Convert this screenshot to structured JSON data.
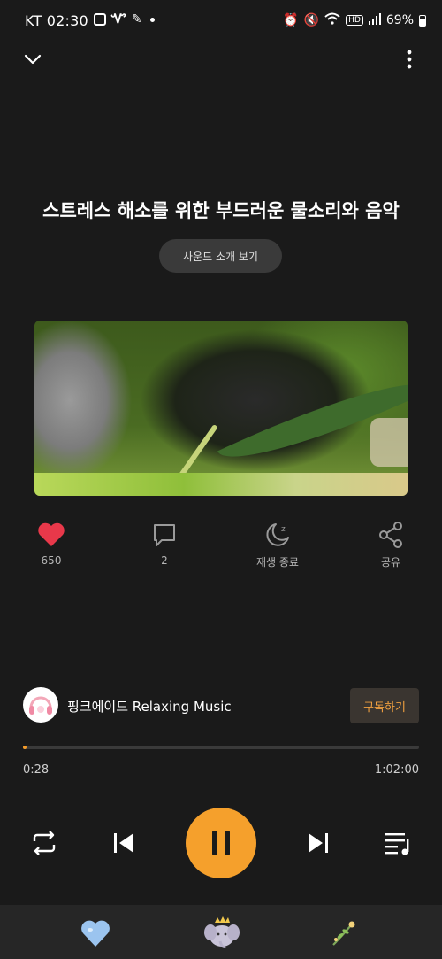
{
  "status_bar": {
    "carrier": "KT",
    "time": "02:30",
    "battery": "69%"
  },
  "track": {
    "title": "스트레스 해소를 위한 부드러운 물소리와 음악",
    "intro_button": "사운드 소개 보기"
  },
  "actions": {
    "like_count": "650",
    "comment_count": "2",
    "sleep_timer_label": "재생 종료",
    "share_label": "공유"
  },
  "channel": {
    "name": "핑크에이드 Relaxing Music",
    "subscribe_label": "구독하기"
  },
  "playback": {
    "current_time": "0:28",
    "total_time": "1:02:00",
    "progress_fraction": 0.0075
  },
  "colors": {
    "accent": "#f5a02c",
    "like": "#e8384a",
    "background": "#1a1a1a"
  },
  "icons": [
    "chevron-down-icon",
    "more-vertical-icon",
    "heart-icon",
    "comment-icon",
    "moon-icon",
    "share-icon",
    "repeat-icon",
    "skip-previous-icon",
    "pause-icon",
    "skip-next-icon",
    "playlist-icon",
    "heart-balloon-icon",
    "elephant-icon",
    "flower-icon"
  ]
}
